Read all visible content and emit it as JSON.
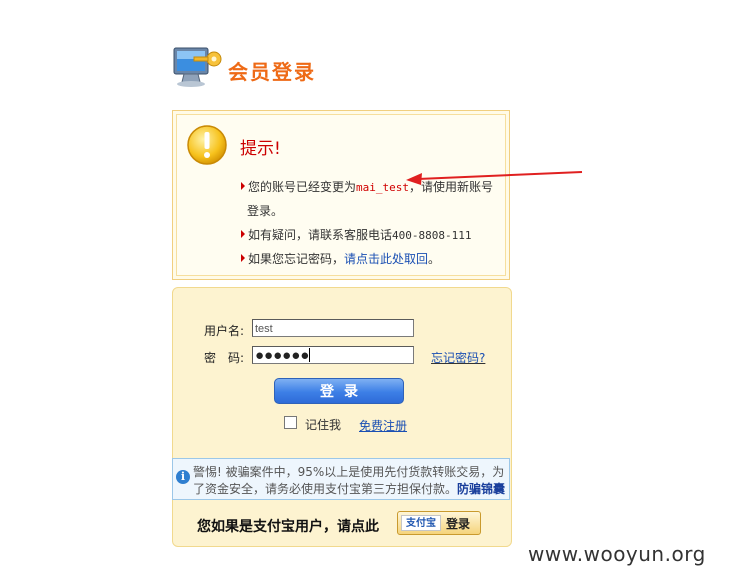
{
  "header": {
    "title": "会员登录"
  },
  "notice": {
    "title": "提示!",
    "line1_prefix": "您的账号已经变更为",
    "line1_account": "mai_test",
    "line1_suffix": "，请使用新账号",
    "line1_cont": "登录。",
    "line2_prefix": "如有疑问，请联系客服电话",
    "line2_phone": "400-8808-111",
    "line3_prefix": "如果您忘记密码，",
    "line3_link": "请点击此处取回",
    "line3_suffix": "。"
  },
  "login": {
    "username_label": "用户名:",
    "username_value": "test",
    "password_label": "密　码:",
    "password_dots": "●●●●●●",
    "forgot_link": "忘记密码?",
    "submit_label": "登录",
    "remember_label": "记住我",
    "register_link": "免费注册"
  },
  "warning": {
    "line1": "警惕! 被骗案件中，95%以上是使用先付货款转账交易，为",
    "line2": "了资金安全，请务必使用支付宝第三方担保付款。",
    "link": "防骗锦囊"
  },
  "alipay": {
    "prompt": "您如果是支付宝用户，请点此",
    "logo_text": "支付宝",
    "login_label": "登录"
  },
  "watermark": "www.wooyun.org",
  "colors": {
    "accent_orange": "#ee6a16",
    "alert_red": "#cc0000",
    "link_blue": "#1a4fb3",
    "button_blue": "#3d7fe6"
  }
}
